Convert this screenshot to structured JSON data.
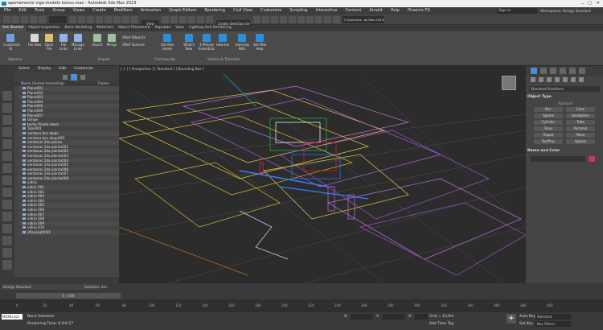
{
  "title": "apartamento viga-modelo bonus.max - Autodesk 3ds Max 2023",
  "menu": [
    "File",
    "Edit",
    "Tools",
    "Group",
    "Views",
    "Create",
    "Modifiers",
    "Animation",
    "Graph Editors",
    "Rendering",
    "Civil View",
    "Customize",
    "Scripting",
    "Interactive",
    "Content",
    "Arnold",
    "Help",
    "Phoenix FD"
  ],
  "signin": "Sign In",
  "workspaces": "Workspaces: Design Standard",
  "path": "C:\\Users\\fd...ds Max 2023\\",
  "selection_set": "Create Selection Se",
  "view_dropdown": "View",
  "ribbon_tabs": [
    "Get Started",
    "Object Inspection",
    "Basic Modeling",
    "Materials",
    "Object Placement",
    "Populate",
    "View",
    "Lighting And Rendering"
  ],
  "ribbon_buttons": [
    {
      "label": "Customize UI",
      "color": "#6f9fd8"
    },
    {
      "label": "File New",
      "color": "#d9d9d9"
    },
    {
      "label": "Open File",
      "color": "#e0c070"
    },
    {
      "label": "File Links",
      "color": "#8fb4e6"
    },
    {
      "label": "Manage Links",
      "color": "#8fb4e6"
    },
    {
      "label": "Import",
      "color": "#9fc0a0"
    },
    {
      "label": "Merge",
      "color": "#9fc0a0"
    },
    {
      "label": "3ds Max Home",
      "color": "#2e8fd8"
    },
    {
      "label": "What's New",
      "color": "#2e8fd8"
    },
    {
      "label": "1-Minute Essentials",
      "color": "#2e8fd8"
    },
    {
      "label": "How-tos",
      "color": "#2e8fd8"
    },
    {
      "label": "Learning Path",
      "color": "#2e8fd8"
    },
    {
      "label": "3ds Max Help",
      "color": "#2e8fd8"
    }
  ],
  "xref": [
    "XRef Objects",
    "XRef Scenes"
  ],
  "ribbon_groups": [
    "Options",
    "Import",
    "Community",
    "Videos & Tutorials"
  ],
  "explorer": {
    "menu": [
      "Select",
      "Display",
      "Edit",
      "Customize"
    ],
    "header_name": "Name (Sorted Ascending)",
    "header_frozen": "Frozen",
    "items": [
      "Plane001",
      "Plane002",
      "Plane003",
      "Plane004",
      "Plane005",
      "Plane006",
      "Plane007",
      "lâmpe",
      "techo Pronto dwen",
      "Tubo001",
      "ventana bco abajo",
      "ventana bco abajo001",
      "ventanas  2da planta",
      "ventanas  2da planta001",
      "ventanas  2da planta002",
      "ventanas  2da planta003",
      "ventanas  2da planta004",
      "ventanas  2da planta005",
      "ventanas  2da planta006",
      "ventanas  2da planta007",
      "ventanas  2da planta008",
      "vidrio",
      "vidrio 001",
      "vidrio 002",
      "vidrio 003",
      "vidrio 004",
      "vidrio 005",
      "vidrio 006",
      "vidrio 007",
      "vidrio 008",
      "vidrio 009",
      "vidrio 010",
      "VRayLight001"
    ]
  },
  "viewport_label": "[ + ] [ Perspective ] [ Standard ] [ Bounding Box ]",
  "command_panel": {
    "dropdown": "Standard Primitives",
    "object_type": "Object Type",
    "autogrid": "AutoGrid",
    "buttons": [
      "Box",
      "Cone",
      "Sphere",
      "GeoSphere",
      "Cylinder",
      "Tube",
      "Torus",
      "Pyramid",
      "Teapot",
      "Plane",
      "TextPlus",
      "Sphere"
    ],
    "name_color": "Name and Color",
    "swatch": "#c8307a"
  },
  "time": {
    "frame": "0 / 400",
    "ticks": [
      "0",
      "20",
      "40",
      "60",
      "80",
      "100",
      "120",
      "140",
      "160",
      "180",
      "200",
      "220",
      "240",
      "260",
      "280",
      "300",
      "320",
      "340",
      "360",
      "380",
      "400"
    ]
  },
  "status": {
    "workspace": "Design Standard",
    "selection_set": "Selection Set:",
    "none_selected": "None Selected",
    "render_time": "Rendering Time: 0:0:0:27",
    "maxscript": "MAXScript",
    "x": "X:",
    "y": "Y:",
    "z": "Z:",
    "grid": "Grid = 10,0m",
    "add_time_tag": "Add Time Tag",
    "auto_key": "Auto Key",
    "set_key": "Set Key",
    "selected": "Selected",
    "key_filters": "Key Filters..."
  }
}
